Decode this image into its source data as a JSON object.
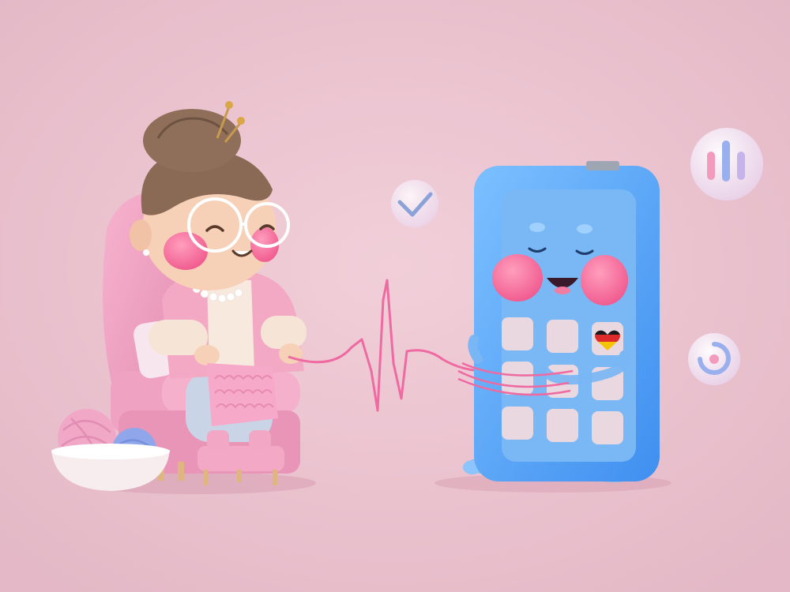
{
  "scene": {
    "background": "#ebc3cf",
    "characters": {
      "grandmother": {
        "activity": "knitting",
        "hair": "#8a6a55",
        "cardigan": "#f3a9c4"
      },
      "phone": {
        "body": "#5aa6f2",
        "screen": "#7ab7f5",
        "flag": [
          "#1a1a1a",
          "#dd2b2b",
          "#f5c400"
        ]
      }
    },
    "yarn": {
      "thread": "#ee6aa0",
      "balls": [
        "#f1a8c6",
        "#8fa7ea"
      ]
    },
    "floating_icons": [
      "checkmark-icon",
      "audio-bars-icon",
      "refresh-icon"
    ]
  }
}
